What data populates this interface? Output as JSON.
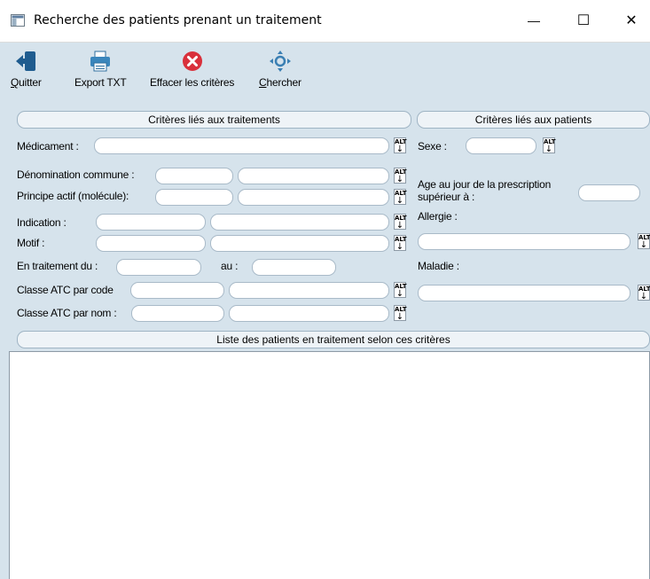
{
  "window": {
    "title": "Recherche des patients prenant un traitement",
    "controls": {
      "minimize": "—",
      "maximize": "☐",
      "close": "✕"
    }
  },
  "toolbar": {
    "items": [
      {
        "label": "Quitter",
        "accesskey": "Q",
        "rest": "uitter",
        "icon": "exit-icon"
      },
      {
        "label": "Export TXT",
        "icon": "printer-icon"
      },
      {
        "label": "Effacer les critères",
        "icon": "clear-icon"
      },
      {
        "label": "Chercher",
        "accesskey": "C",
        "rest": "hercher",
        "icon": "search-icon"
      }
    ]
  },
  "sections": {
    "traitements": "Critères liés aux traitements",
    "patients": "Critères liés aux patients",
    "liste": "Liste des patients en traitement selon ces critères"
  },
  "left": {
    "medicament": "Médicament :",
    "denomination": "Dénomination commune :",
    "principe": "Principe actif (molécule):",
    "indication": "Indication :",
    "motif": "Motif :",
    "en_traitement": "En traitement du :",
    "au": "au :",
    "atc_code": "Classe ATC par code",
    "atc_nom": "Classe ATC par nom :"
  },
  "right": {
    "sexe": "Sexe :",
    "age_line1": "Age au jour de la prescription",
    "age_line2": "supérieur à :",
    "allergie": "Allergie :",
    "maladie": "Maladie :"
  },
  "alt_button": {
    "top": "ALT",
    "arrow": "↓"
  },
  "colors": {
    "panel": "#d6e3ec",
    "section": "#eef3f7",
    "exit": "#1f5c8f",
    "clear": "#d9303b"
  }
}
